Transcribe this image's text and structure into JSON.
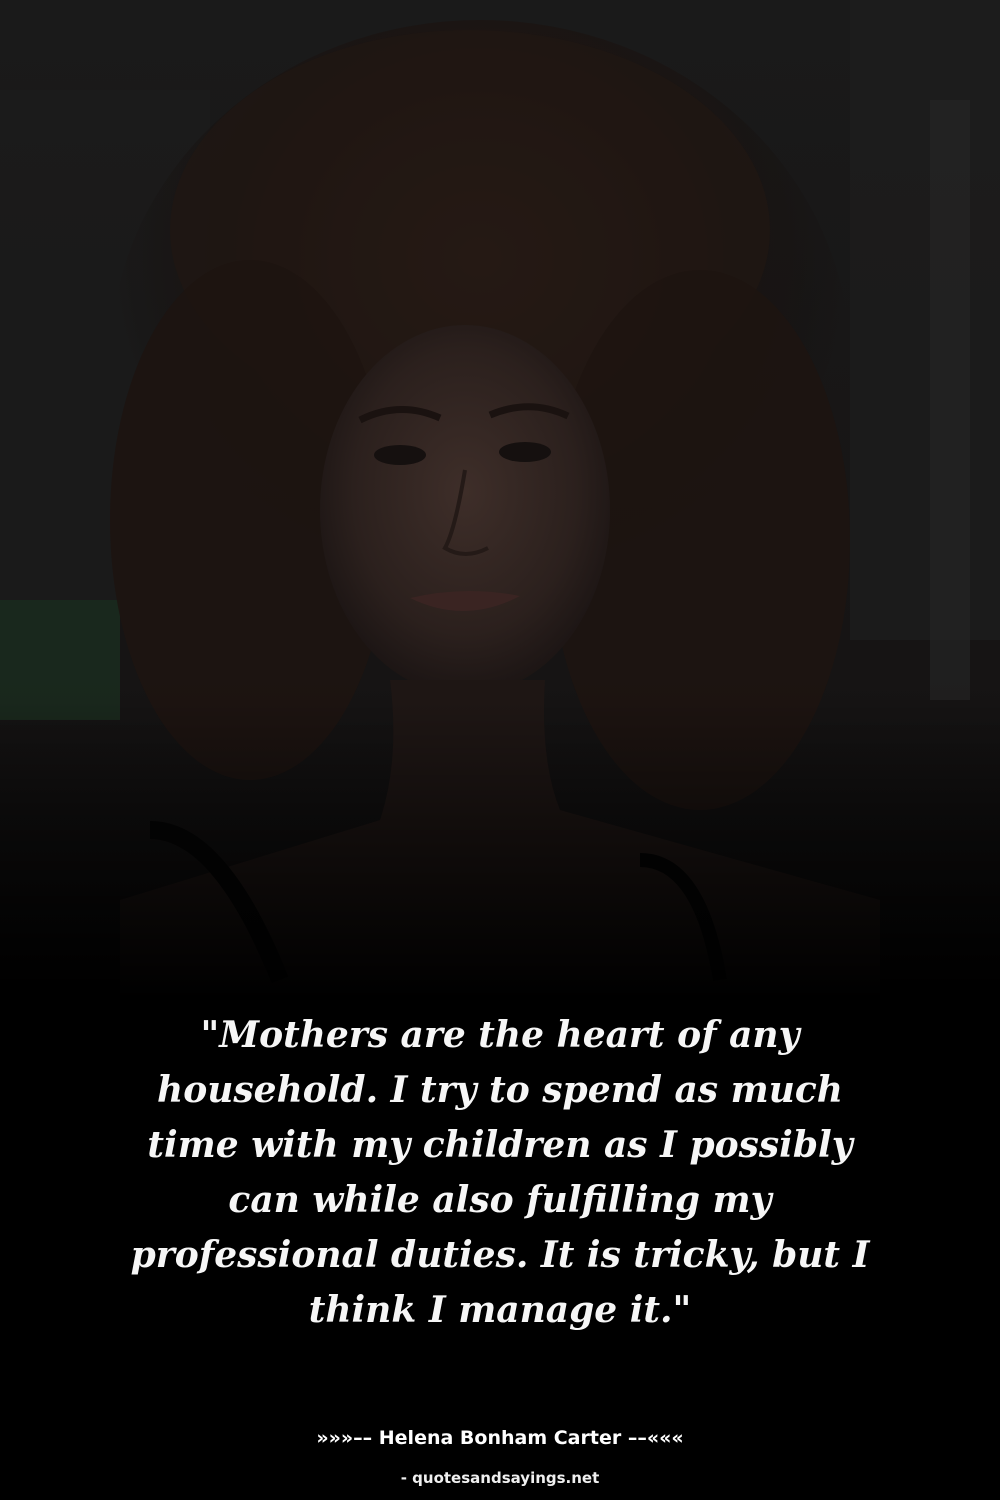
{
  "quote": {
    "text": "\"Mothers are the heart of any household. I try to spend as much time with my children as I possibly can while also fulfilling my professional duties. It is tricky, but I think I manage it.\""
  },
  "attribution": {
    "author_line": "»»»–– Helena Bonham Carter ––«««",
    "source": "- quotesandsayings.net"
  },
  "colors": {
    "background": "#000000",
    "text": "#f6f6f6"
  }
}
